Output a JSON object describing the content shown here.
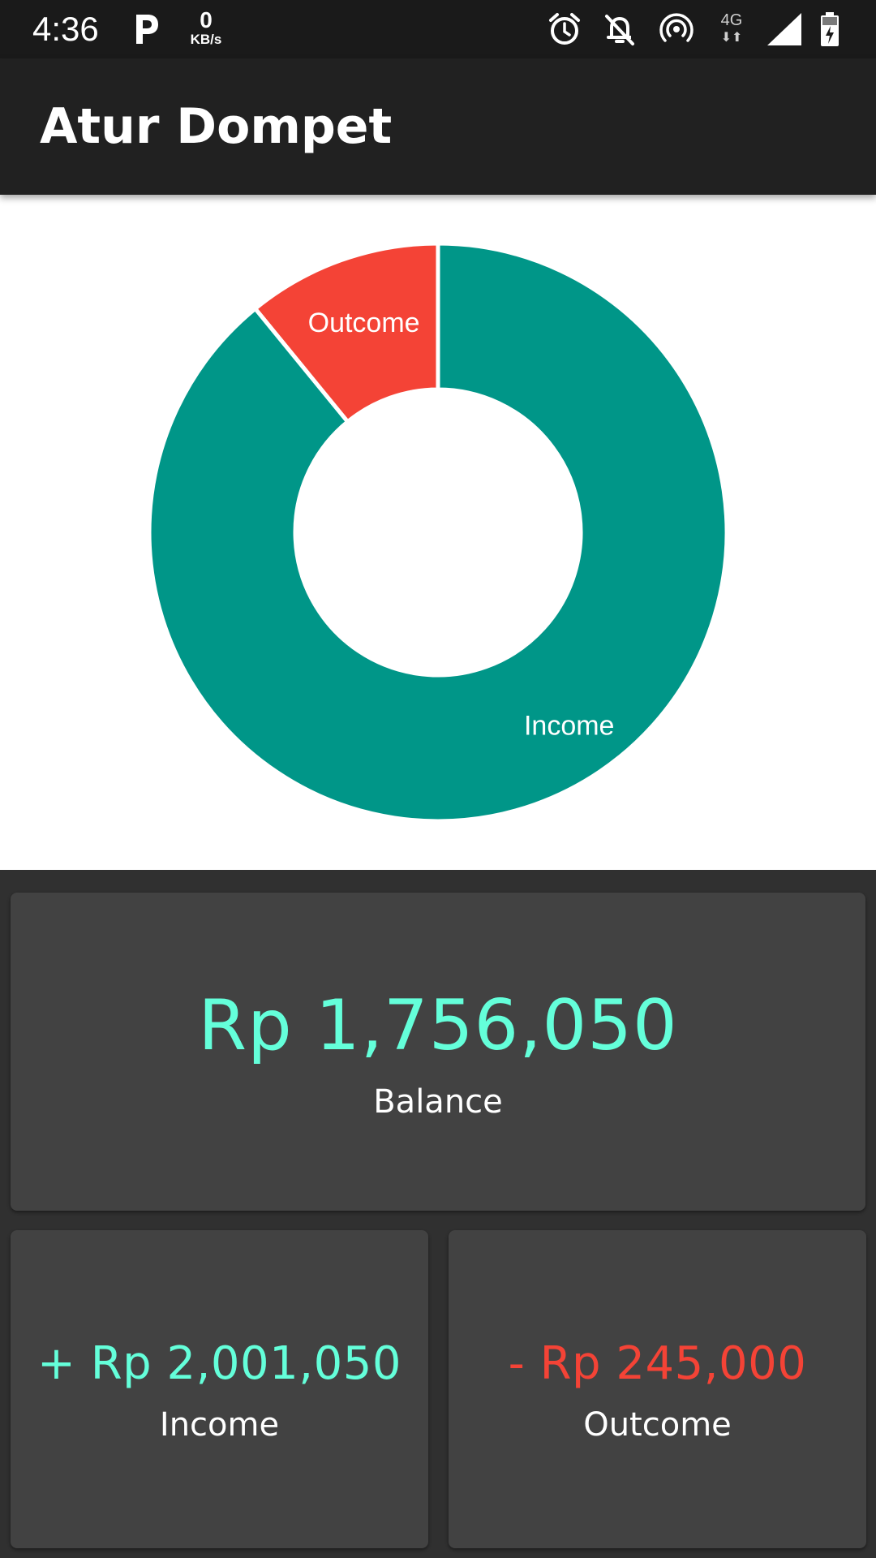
{
  "status_bar": {
    "time": "4:36",
    "network_speed_value": "0",
    "network_speed_unit": "KB/s",
    "network_type": "4G",
    "icons": [
      "parking-icon",
      "alarm-icon",
      "notifications-off-icon",
      "hotspot-icon",
      "signal-icon",
      "battery-charging-icon"
    ]
  },
  "app_bar": {
    "title": "Atur Dompet"
  },
  "chart_data": {
    "type": "pie",
    "donut": true,
    "slices": [
      {
        "label": "Income",
        "value": 2001050,
        "color": "#009688"
      },
      {
        "label": "Outcome",
        "value": 245000,
        "color": "#f44336"
      }
    ]
  },
  "summary": {
    "balance": {
      "amount": "Rp 1,756,050",
      "label": "Balance"
    },
    "income": {
      "amount": "+ Rp 2,001,050",
      "label": "Income"
    },
    "outcome": {
      "amount": "- Rp 245,000",
      "label": "Outcome"
    }
  },
  "colors": {
    "positive": "#64ffda",
    "negative": "#f44336",
    "card": "#424242",
    "background": "#303030",
    "app_bar": "#212121"
  }
}
